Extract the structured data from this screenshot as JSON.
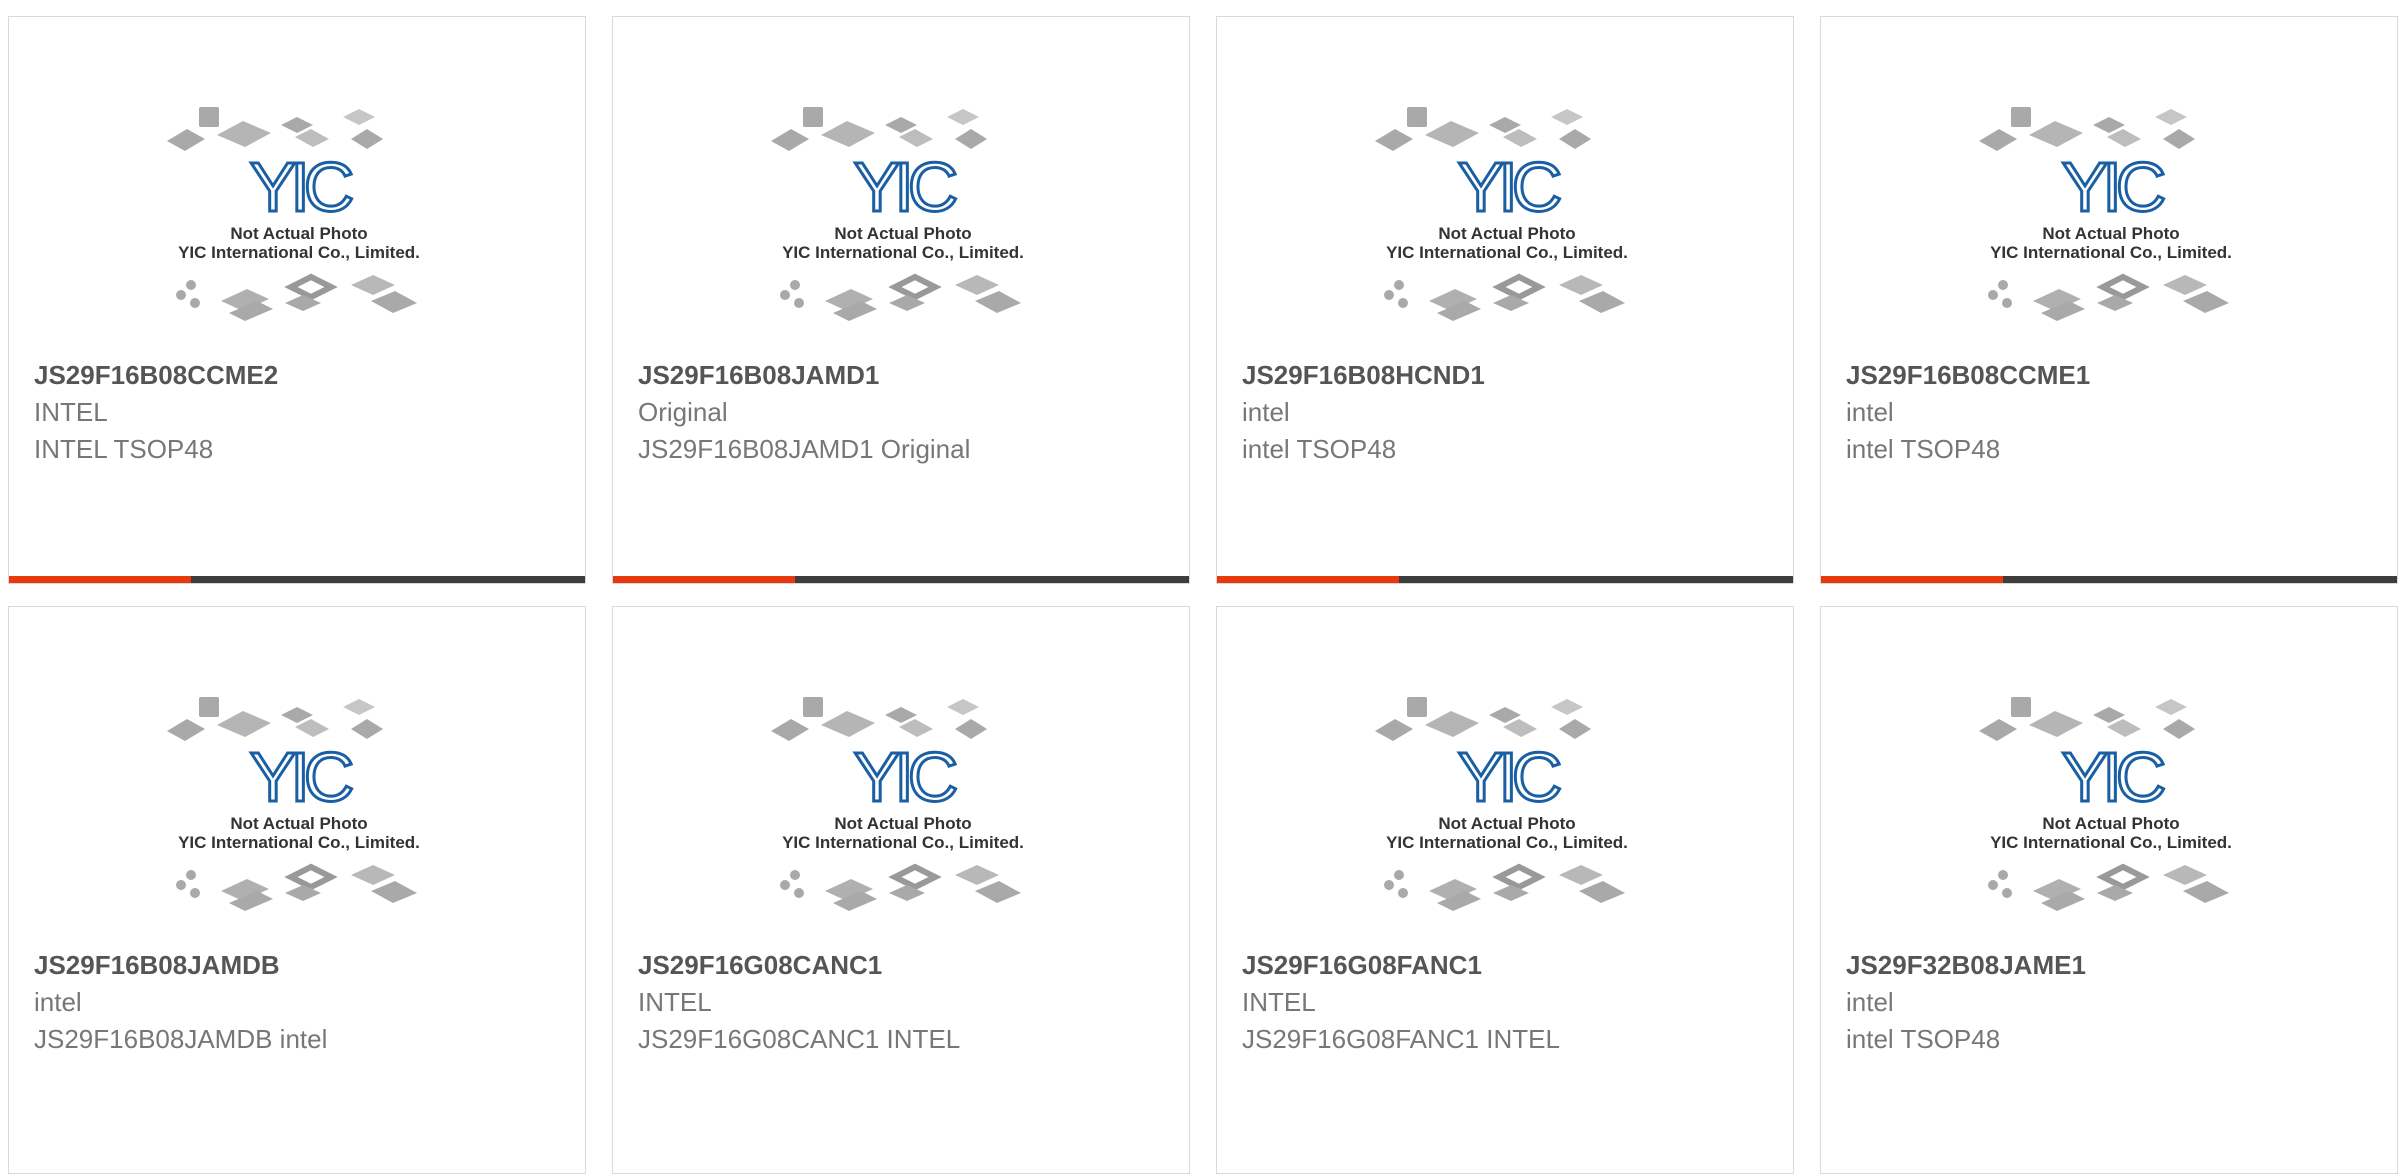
{
  "placeholder": {
    "line1": "Not Actual Photo",
    "line2": "YIC International Co., Limited.",
    "logo": "YIC"
  },
  "colors": {
    "accent": "#e8380d",
    "bar": "#3d3d3d",
    "logo": "#1a5fa3"
  },
  "products": [
    {
      "part": "JS29F16B08CCME2",
      "brand": "INTEL",
      "desc": "INTEL TSOP48"
    },
    {
      "part": "JS29F16B08JAMD1",
      "brand": "Original",
      "desc": "JS29F16B08JAMD1 Original"
    },
    {
      "part": "JS29F16B08HCND1",
      "brand": "intel",
      "desc": "intel TSOP48"
    },
    {
      "part": "JS29F16B08CCME1",
      "brand": "intel",
      "desc": "intel TSOP48"
    },
    {
      "part": "JS29F16B08JAMDB",
      "brand": "intel",
      "desc": "JS29F16B08JAMDB intel"
    },
    {
      "part": "JS29F16G08CANC1",
      "brand": "INTEL",
      "desc": "JS29F16G08CANC1 INTEL"
    },
    {
      "part": "JS29F16G08FANC1",
      "brand": "INTEL",
      "desc": "JS29F16G08FANC1 INTEL"
    },
    {
      "part": "JS29F32B08JAME1",
      "brand": "intel",
      "desc": "intel TSOP48"
    }
  ]
}
